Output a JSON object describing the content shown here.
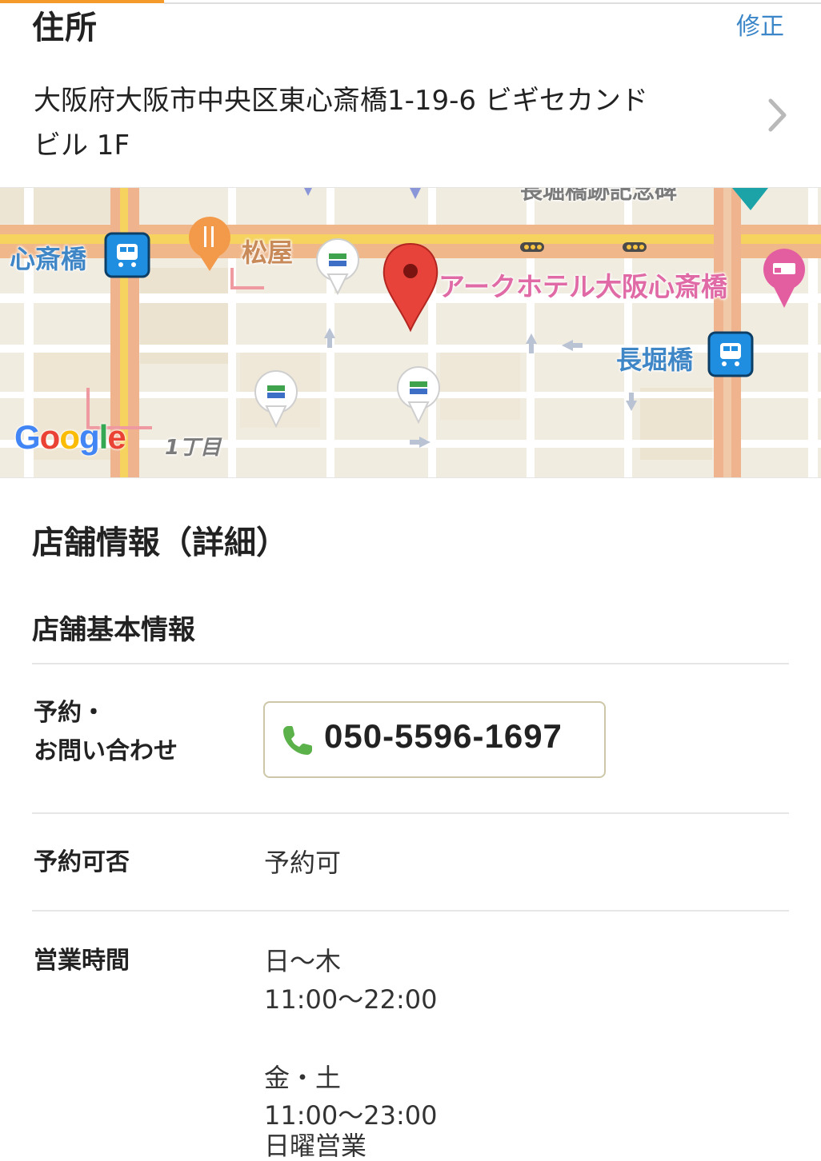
{
  "address": {
    "title": "住所",
    "edit_label": "修正",
    "line1": "大阪府大阪市中央区東心斎橋1-19-6 ビギセカンド",
    "line2": "ビル 1F"
  },
  "map": {
    "labels": {
      "station_shinsaibashi": "心斎橋",
      "store_matsuya": "松屋",
      "hotel": "アークホテル大阪心斎橋",
      "station_nagahori": "長堀橋",
      "district": "1丁目",
      "top_partial": "長堀橋跡記念碑"
    },
    "google_logo": [
      "G",
      "o",
      "o",
      "g",
      "l",
      "e"
    ]
  },
  "details": {
    "title": "店舗情報（詳細）",
    "basic_title": "店舗基本情報",
    "reservation_contact_label_1": "予約・",
    "reservation_contact_label_2": "お問い合わせ",
    "phone": "050-5596-1697",
    "reservation_label": "予約可否",
    "reservation_value": "予約可",
    "hours_label": "営業時間",
    "hours": {
      "days1": "日～木",
      "time1": "11:00～22:00",
      "days2": "金・土",
      "time2": "11:00～23:00",
      "note": "日曜営業"
    }
  },
  "colors": {
    "accent": "#f39a2b",
    "link": "#3a86c8",
    "map_pin": "#e8433b",
    "phone_icon": "#5bb14a"
  }
}
